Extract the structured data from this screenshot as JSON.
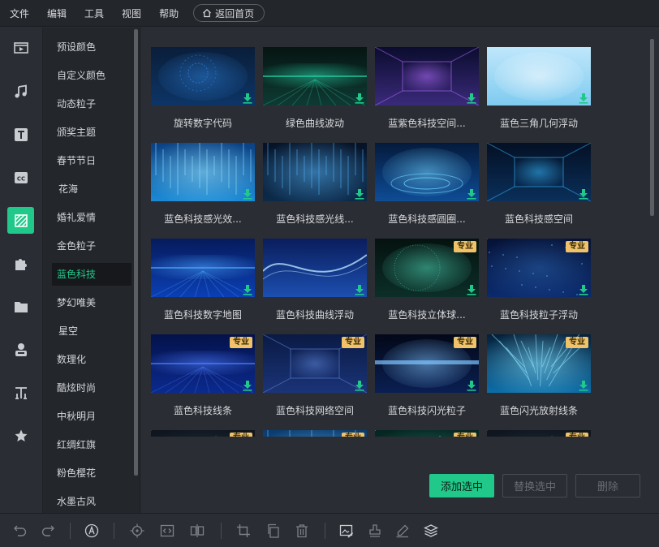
{
  "menubar": {
    "items": [
      "文件",
      "编辑",
      "工具",
      "视图",
      "帮助"
    ],
    "home_label": "返回首页"
  },
  "rail": {
    "icons": [
      "media-icon",
      "music-icon",
      "text-icon",
      "caption-icon",
      "background-icon",
      "plugin-icon",
      "folder-icon",
      "character-icon",
      "title-icon",
      "favorite-icon"
    ],
    "active_index": 4
  },
  "categories": {
    "items": [
      "预设颜色",
      "自定义颜色",
      "动态粒子",
      "颁奖主题",
      "春节节日",
      "花海",
      "婚礼爱情",
      "金色粒子",
      "蓝色科技",
      "梦幻唯美",
      "星空",
      "数理化",
      "酷炫时尚",
      "中秋明月",
      "红绸红旗",
      "粉色樱花",
      "水墨古风"
    ],
    "active": "蓝色科技"
  },
  "grid": {
    "pro_label": "专业",
    "tiles": [
      {
        "title": "旋转数字代码",
        "pro": false,
        "theme": "spiral"
      },
      {
        "title": "绿色曲线波动",
        "pro": false,
        "theme": "greenwave"
      },
      {
        "title": "蓝紫色科技空间...",
        "pro": false,
        "theme": "tunnel"
      },
      {
        "title": "蓝色三角几何浮动",
        "pro": false,
        "theme": "lightsky"
      },
      {
        "title": "蓝色科技感光效...",
        "pro": false,
        "theme": "lightrain"
      },
      {
        "title": "蓝色科技感光线...",
        "pro": false,
        "theme": "darkrain"
      },
      {
        "title": "蓝色科技感圆圈...",
        "pro": false,
        "theme": "rings"
      },
      {
        "title": "蓝色科技感空间",
        "pro": false,
        "theme": "circuit"
      },
      {
        "title": "蓝色科技数字地图",
        "pro": false,
        "theme": "map"
      },
      {
        "title": "蓝色科技曲线浮动",
        "pro": false,
        "theme": "curves"
      },
      {
        "title": "蓝色科技立体球...",
        "pro": true,
        "theme": "globe"
      },
      {
        "title": "蓝色科技粒子浮动",
        "pro": true,
        "theme": "particles"
      },
      {
        "title": "蓝色科技线条",
        "pro": true,
        "theme": "lines"
      },
      {
        "title": "蓝色科技网络空间",
        "pro": true,
        "theme": "network"
      },
      {
        "title": "蓝色科技闪光粒子",
        "pro": true,
        "theme": "sparkle"
      },
      {
        "title": "蓝色闪光放射线条",
        "pro": true,
        "theme": "radial"
      },
      {
        "title": "",
        "pro": true,
        "theme": "dark"
      },
      {
        "title": "",
        "pro": true,
        "theme": "curtain"
      },
      {
        "title": "",
        "pro": true,
        "theme": "teal"
      },
      {
        "title": "",
        "pro": true,
        "theme": "dark"
      }
    ]
  },
  "actions": {
    "add": "添加选中",
    "replace": "替换选中",
    "delete": "删除"
  },
  "toolbar": {
    "tools": [
      "undo-icon",
      "redo-icon",
      "auto-icon",
      "locate-icon",
      "code-icon",
      "split-icon",
      "crop-icon",
      "copy-icon",
      "trash-icon",
      "image-edit-icon",
      "stamp-icon",
      "pencil-icon",
      "layers-icon"
    ]
  },
  "colors": {
    "accent": "#20c98a",
    "pro_badge": "#f0c36a",
    "background": "#2a2d33"
  }
}
